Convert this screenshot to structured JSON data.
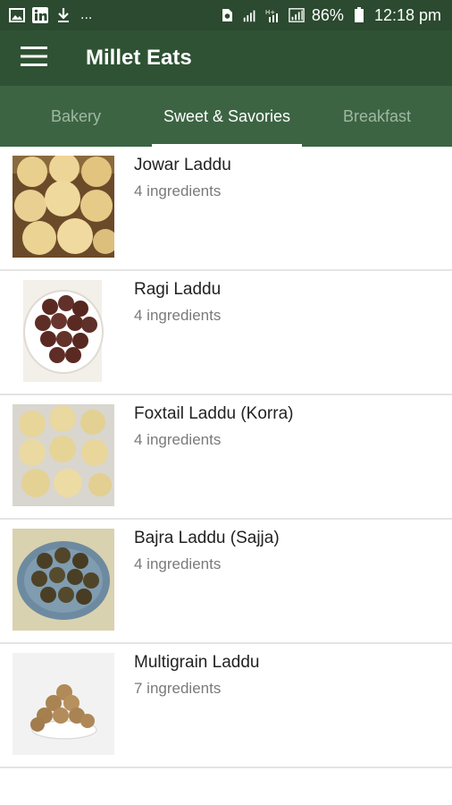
{
  "status_bar": {
    "left_icons": [
      "image-icon",
      "linkedin-icon",
      "download-icon"
    ],
    "more": "...",
    "battery": "86%",
    "time": "12:18 pm"
  },
  "app_bar": {
    "title": "Millet Eats"
  },
  "tabs": [
    {
      "label": "Bakery",
      "selected": false
    },
    {
      "label": "Sweet & Savories",
      "selected": true
    },
    {
      "label": "Breakfast",
      "selected": false
    }
  ],
  "recipes": [
    {
      "title": "Jowar Laddu",
      "ingredients": "4 ingredients"
    },
    {
      "title": "Ragi Laddu",
      "ingredients": "4 ingredients"
    },
    {
      "title": "Foxtail Laddu (Korra)",
      "ingredients": "4 ingredients"
    },
    {
      "title": "Bajra Laddu (Sajja)",
      "ingredients": "4 ingredients"
    },
    {
      "title": "Multigrain Laddu",
      "ingredients": "7 ingredients"
    }
  ],
  "colors": {
    "status_bar": "#2b4a2f",
    "app_bar": "#2f5234",
    "tab_bar": "#3c6443",
    "tab_selected": "#ffffff",
    "tab_unselected": "#9fb8a2"
  }
}
